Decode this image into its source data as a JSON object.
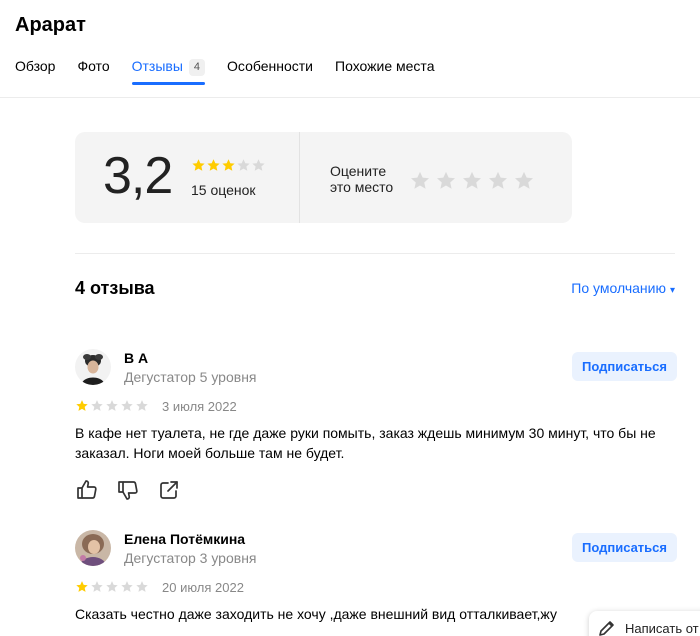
{
  "place": {
    "title": "Арарат"
  },
  "tabs": [
    {
      "label": "Обзор"
    },
    {
      "label": "Фото"
    },
    {
      "label": "Отзывы",
      "count": "4",
      "active": true
    },
    {
      "label": "Особенности"
    },
    {
      "label": "Похожие места"
    }
  ],
  "rating": {
    "score": "3,2",
    "stars_filled": 3,
    "stars_total": 5,
    "count_text": "15 оценок",
    "rate_label": "Оцените это место"
  },
  "reviews_header": {
    "count_text": "4 отзыва",
    "sort_label": "По умолчанию",
    "sort_caret": "▾"
  },
  "reviews": [
    {
      "author": "В А",
      "level": "Дегустатор 5 уровня",
      "subscribe_label": "Подписаться",
      "stars": 1,
      "date": "3 июля 2022",
      "text": "В кафе нет туалета, не где даже руки помыть, заказ ждешь минимум 30 минут, что бы не заказал. Ноги моей больше там не будет.",
      "actions": [
        "thumbs-up-icon",
        "thumbs-down-icon",
        "share-icon"
      ]
    },
    {
      "author": "Елена Потёмкина",
      "level": "Дегустатор 3 уровня",
      "subscribe_label": "Подписаться",
      "stars": 1,
      "date": "20 июля 2022",
      "text": "Сказать честно даже заходить не хочу ,даже внешний вид отталкивает,жу"
    }
  ],
  "write_review": {
    "label": "Написать от"
  },
  "colors": {
    "accent": "#196dff",
    "star_filled": "#ffcc00",
    "star_empty": "#d9d9d9",
    "card_bg": "#f4f4f4"
  }
}
